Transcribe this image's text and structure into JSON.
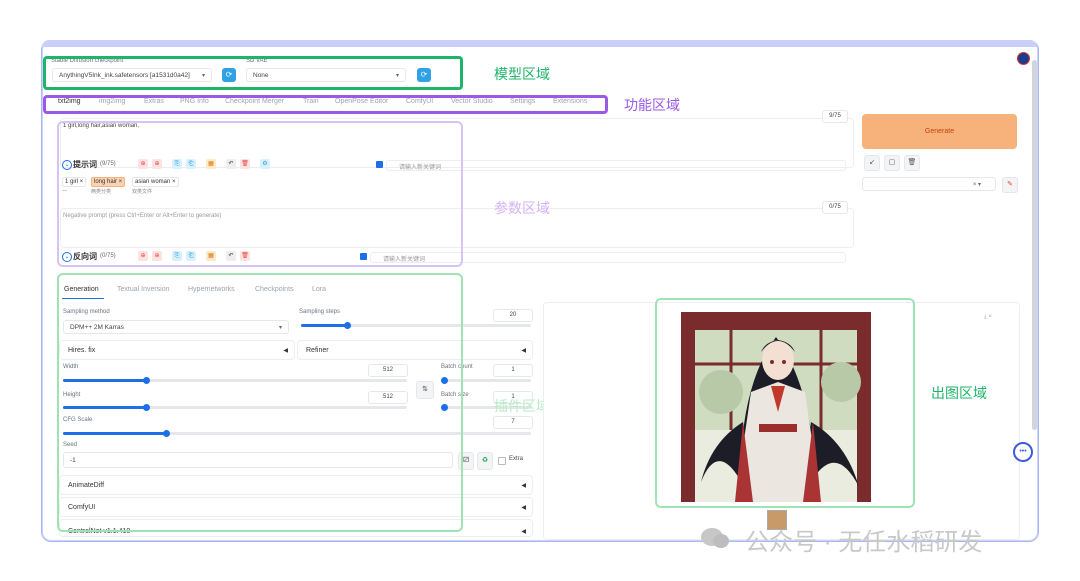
{
  "checkpoint": {
    "label": "Stable Diffusion checkpoint",
    "value": "AnythingV5Ink_ink.safetensors [a1531d0a42]"
  },
  "vae": {
    "label": "SD VAE",
    "value": "None"
  },
  "tabs": [
    "txt2img",
    "img2img",
    "Extras",
    "PNG Info",
    "Checkpoint Merger",
    "Train",
    "OpenPose Editor",
    "ComfyUI",
    "Vector Studio",
    "Settings",
    "Extensions"
  ],
  "prompt": {
    "text": "1 girl,long hair,asian woman,",
    "counter": "9/75",
    "toolbar_label": "提示词",
    "toolbar_count": "(9/75)",
    "keyword_placeholder": "请输入新关键词",
    "chips": [
      "1 girl",
      "long hair",
      "asian woman"
    ],
    "sub_labels": [
      "一",
      "两类分类",
      "双类文件"
    ]
  },
  "negative": {
    "placeholder": "Negative prompt (press Ctrl+Enter or Alt+Enter to generate)",
    "counter": "0/75",
    "toolbar_label": "反向词",
    "toolbar_count": "(0/75)",
    "keyword_placeholder": "请输入新关键词"
  },
  "generate_label": "Generate",
  "subtabs": [
    "Generation",
    "Textual Inversion",
    "Hypernetworks",
    "Checkpoints",
    "Lora"
  ],
  "sampling": {
    "method_label": "Sampling method",
    "method_value": "DPM++ 2M Karras",
    "steps_label": "Sampling steps",
    "steps_value": "20",
    "steps_fraction": 0.2
  },
  "hires_label": "Hires. fix",
  "refiner_label": "Refiner",
  "width": {
    "label": "Width",
    "value": "512",
    "fraction": 0.24
  },
  "height": {
    "label": "Height",
    "value": "512",
    "fraction": 0.24
  },
  "batch_count": {
    "label": "Batch count",
    "value": "1"
  },
  "batch_size": {
    "label": "Batch size",
    "value": "1"
  },
  "cfg": {
    "label": "CFG Scale",
    "value": "7",
    "fraction": 0.22
  },
  "seed": {
    "label": "Seed",
    "value": "-1",
    "extra_label": "Extra"
  },
  "sections": [
    "AnimateDiff",
    "ComfyUI",
    "ControlNet v1.1.410"
  ],
  "annotations": {
    "model": "模型区域",
    "function": "功能区域",
    "params": "参数区域",
    "plugins": "插件区域和扩展参数",
    "output": "出图区域"
  },
  "watermark": "公众号 · 无任水稻研发",
  "colors": {
    "green": "#1fb46a",
    "purple": "#9b59e8",
    "lavender": "#d8c4f4",
    "mint": "#9fe3b4",
    "generate": "#f7b27b",
    "accent": "#1d6fe8"
  },
  "icons": [
    "refresh-icon",
    "arrow-icon",
    "copy-icon",
    "trash-icon",
    "pencil-icon",
    "recycle-icon",
    "dice-icon",
    "swap-icon",
    "chat-bubble-icon"
  ]
}
